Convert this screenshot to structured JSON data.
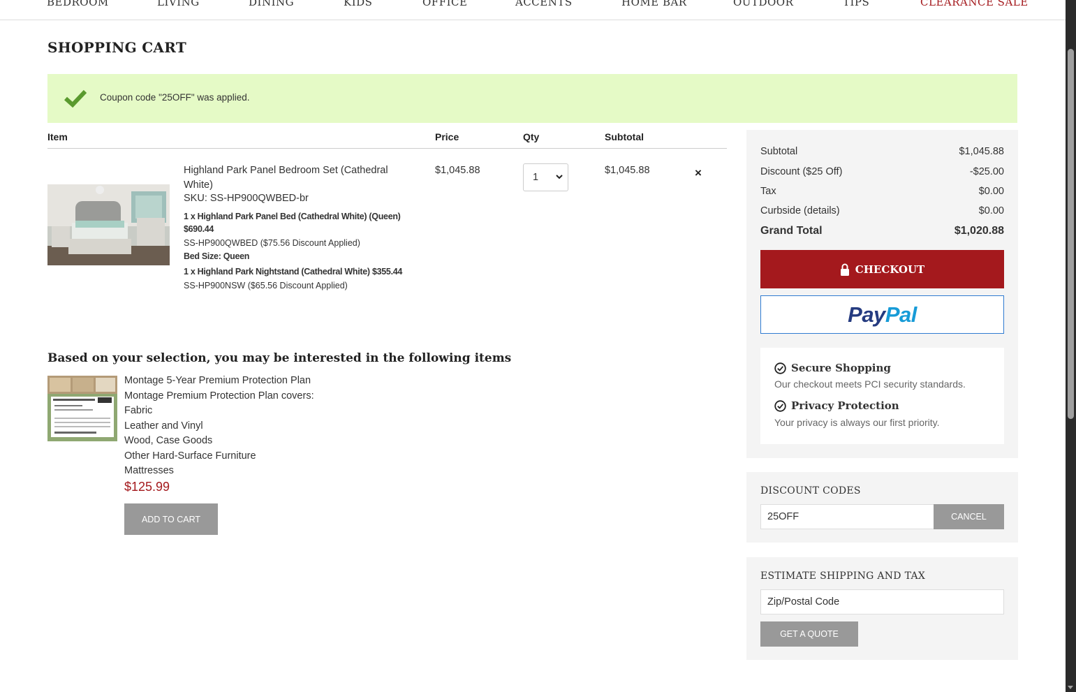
{
  "nav": {
    "items": [
      "BEDROOM",
      "LIVING",
      "DINING",
      "KIDS",
      "OFFICE",
      "ACCENTS",
      "HOME BAR",
      "OUTDOOR",
      "TIPS",
      "CLEARANCE SALE"
    ]
  },
  "page_title": "SHOPPING CART",
  "alert": {
    "message": "Coupon code \"25OFF\" was applied."
  },
  "cart": {
    "headers": {
      "item": "Item",
      "price": "Price",
      "qty": "Qty",
      "subtotal": "Subtotal"
    },
    "item": {
      "name": "Highland Park Panel Bedroom Set (Cathedral White)",
      "sku": "SKU: SS-HP900QWBED-br",
      "options": [
        "1 x Highland Park Panel Bed (Cathedral White) (Queen)",
        "$690.44",
        "SS-HP900QWBED ($75.56 Discount Applied)",
        "Bed Size: Queen",
        "1 x Highland Park Nightstand (Cathedral White) $355.44",
        "SS-HP900NSW ($65.56 Discount Applied)"
      ],
      "price": "$1,045.88",
      "qty": "1",
      "subtotal": "$1,045.88",
      "remove": "×"
    }
  },
  "recommendations": {
    "title": "Based on your selection, you may be interested in the following items",
    "lines": [
      "Montage 5-Year Premium Protection Plan",
      "Montage Premium Protection Plan covers:",
      "Fabric",
      "Leather and Vinyl",
      "Wood, Case Goods",
      "Other Hard-Surface Furniture",
      "Mattresses"
    ],
    "price": "$125.99",
    "add_button": "ADD TO CART"
  },
  "summary": {
    "rows": [
      {
        "label": "Subtotal",
        "value": "$1,045.88"
      },
      {
        "label": "Discount ($25 Off)",
        "value": "-$25.00"
      },
      {
        "label": "Tax",
        "value": "$0.00"
      },
      {
        "label": "Curbside (details)",
        "value": "$0.00"
      }
    ],
    "grand_total": {
      "label": "Grand Total",
      "value": "$1,020.88"
    },
    "checkout_label": "CHECKOUT",
    "paypal": {
      "pay": "Pay",
      "pal": "Pal"
    },
    "trust": {
      "secure_title": "Secure Shopping",
      "secure_text": "Our checkout meets PCI security standards.",
      "privacy_title": "Privacy Protection",
      "privacy_text": "Your privacy is always our first priority."
    }
  },
  "discount": {
    "title": "DISCOUNT CODES",
    "code": "25OFF",
    "cancel": "CANCEL"
  },
  "shipping": {
    "title": "ESTIMATE SHIPPING AND TAX",
    "placeholder": "Zip/Postal Code",
    "button": "GET A QUOTE"
  },
  "colors": {
    "accent": "#a4191d",
    "alert_bg": "#e5fac6",
    "check": "#5a9a2e",
    "paypal_dark": "#253b80",
    "paypal_light": "#179bd7"
  }
}
